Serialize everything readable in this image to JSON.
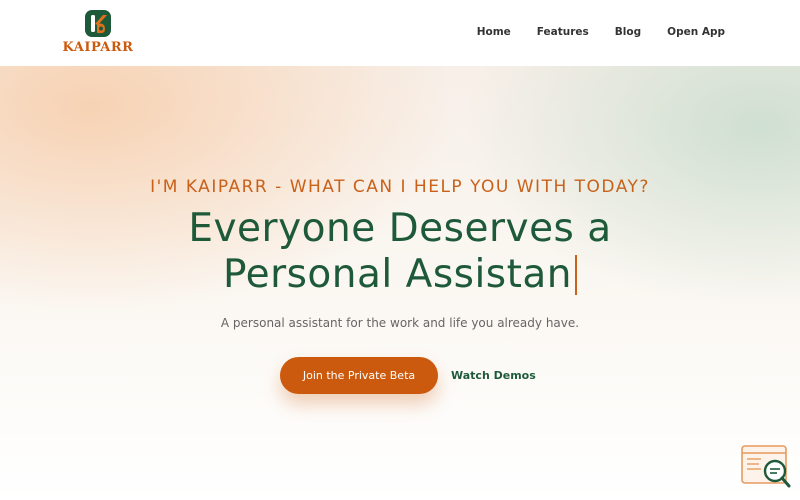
{
  "brand": {
    "name": "KAIPARR",
    "icon": "kaiparr-logo-icon",
    "colors": {
      "orange": "#cc5a0e",
      "green": "#1e5a3a"
    }
  },
  "nav": {
    "items": [
      {
        "label": "Home"
      },
      {
        "label": "Features"
      },
      {
        "label": "Blog"
      },
      {
        "label": "Open App"
      }
    ]
  },
  "hero": {
    "tagline": "I'M KAIPARR - WHAT CAN I HELP YOU WITH TODAY?",
    "headline_line1": "Everyone Deserves a",
    "headline_line2": "Personal Assistan",
    "subtitle": "A personal assistant for the work and life you already have.",
    "primary_cta": "Join the Private Beta",
    "secondary_cta": "Watch Demos"
  },
  "widget": {
    "icon": "search-document-icon"
  }
}
